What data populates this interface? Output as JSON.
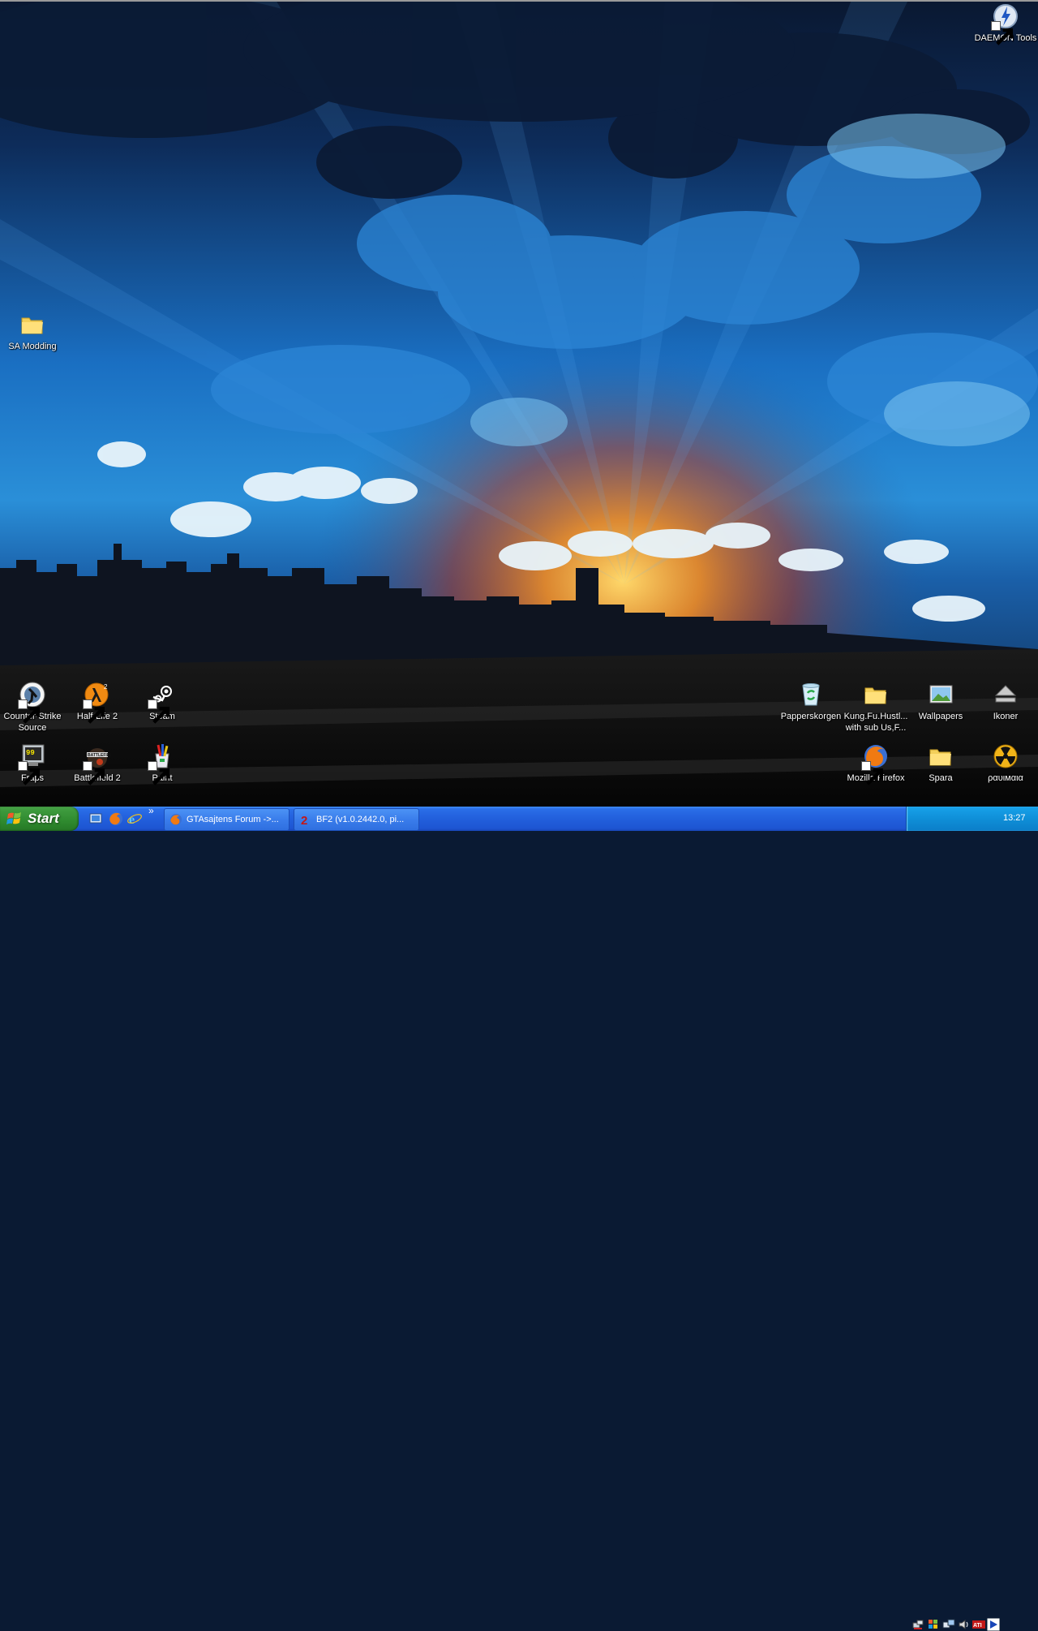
{
  "desktop": {
    "icons": {
      "daemon_tools": "DAEMON Tools",
      "sa_modding": "SA Modding",
      "counter_strike": "Counter-Strike\nSource",
      "half_life": "Half-Life 2",
      "steam": "Steam",
      "fraps": "Fraps",
      "battlefield": "Battlefield 2",
      "paint": "Paint",
      "recycle_bin": "Papperskorgen",
      "kung_fu": "Kung.Fu.Hustl...\nwith sub Us,F...",
      "wallpapers": "Wallpapers",
      "ikoner": "Ikoner",
      "firefox": "Mozilla Firefox",
      "spara": "Spara",
      "radiation": "ραυιмαια"
    }
  },
  "taskbar": {
    "start_label": "Start",
    "tasks": [
      {
        "title": "GTAsajtens Forum ->..."
      },
      {
        "title": "BF2 (v1.0.2442.0, pi..."
      }
    ],
    "quicklaunch_more": "»",
    "clock": "13:27"
  },
  "colors": {
    "taskbar": "#225fdc",
    "start_button": "#3d9a3d",
    "tray": "#0f8fd8",
    "sky_dark": "#0c1c3a",
    "sky_blue": "#1e7fd0",
    "sunset": "#e0631a"
  }
}
